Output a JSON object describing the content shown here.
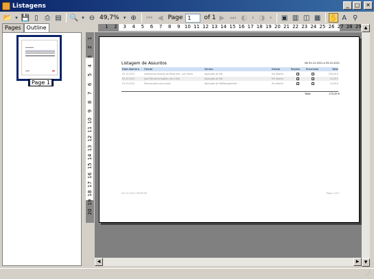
{
  "window": {
    "title": "Listagens",
    "minimize": "_",
    "maximize": "□",
    "close": "✕"
  },
  "toolbar": {
    "zoom": "49,7%",
    "page_label": "Page",
    "page_value": "1",
    "of_pages": "of 1"
  },
  "tabs": [
    {
      "label": "Pages"
    },
    {
      "label": "Outline"
    }
  ],
  "thumbnail": {
    "label": "Page 1"
  },
  "hruler": [
    "1",
    "2",
    "3",
    "4",
    "5",
    "6",
    "7",
    "8",
    "9",
    "10",
    "11",
    "12",
    "13",
    "14",
    "15",
    "16",
    "17",
    "18",
    "19",
    "20",
    "21",
    "22",
    "23",
    "24",
    "25",
    "26",
    "27",
    "28",
    "29"
  ],
  "vruler": [
    "1",
    "2",
    "3",
    "4",
    "5",
    "6",
    "7",
    "8",
    "9",
    "10",
    "11",
    "12",
    "13",
    "14",
    "15",
    "16",
    "17",
    "18",
    "19",
    "20"
  ],
  "report": {
    "title": "Listagem de Assuntos",
    "date_range": "De 01-12-2011 a 03-12-2011",
    "headers": [
      "Data Abertura",
      "Cliente",
      "Senses",
      "Estado",
      "Registo",
      "Encerrado",
      "Valor"
    ],
    "rows": [
      [
        "03-12-2011",
        "Informacao diversa do Texto tuts - juiz Valha",
        "Aquisição de SW",
        "Em Aberto",
        "",
        "",
        "250,00 €"
      ],
      [
        "03-12-2011",
        "Joao Marcao bringsten me a Sha",
        "Aquisição de SW",
        "Em Aberto",
        "",
        "",
        "10,00 €"
      ],
      [
        "03-12-2011",
        "Marcao Joao Louis cuous",
        "Aquisição de SWManagement",
        "Em Aberto",
        "",
        "",
        "10,00 €"
      ]
    ],
    "total_label": "Total:",
    "total_value": "270,00 €",
    "footer_left": "03-12-2011 09:09:05",
    "footer_right": "Page 1 of 1"
  }
}
